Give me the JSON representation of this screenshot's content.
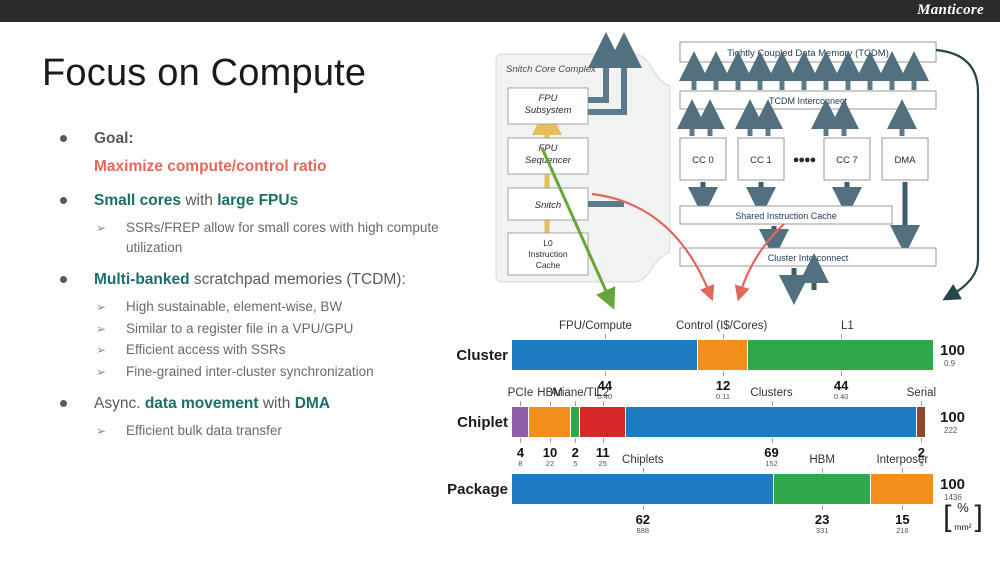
{
  "brand": "Manticore",
  "title": "Focus on Compute",
  "bullets": [
    {
      "kind": "l1",
      "parts": [
        {
          "t": "Goal:",
          "s": "gray-b"
        }
      ]
    },
    {
      "kind": "l1-cont",
      "parts": [
        {
          "t": "Maximize compute/control ratio",
          "s": "coral"
        }
      ]
    },
    {
      "kind": "l1",
      "parts": [
        {
          "t": "Small cores",
          "s": "teal"
        },
        {
          "t": " with ",
          "s": ""
        },
        {
          "t": "large FPUs",
          "s": "teal"
        }
      ]
    },
    {
      "kind": "l2",
      "parts": [
        {
          "t": "SSRs/FREP allow for small cores with high compute utilization",
          "s": ""
        }
      ]
    },
    {
      "kind": "l1",
      "parts": [
        {
          "t": "Multi-banked",
          "s": "teal"
        },
        {
          "t": " scratchpad memories (TCDM):",
          "s": ""
        }
      ]
    },
    {
      "kind": "l2",
      "parts": [
        {
          "t": "High sustainable, element-wise, BW",
          "s": ""
        }
      ]
    },
    {
      "kind": "l2",
      "parts": [
        {
          "t": "Similar to a register file in a VPU/GPU",
          "s": ""
        }
      ]
    },
    {
      "kind": "l2",
      "parts": [
        {
          "t": "Efficient access with SSRs",
          "s": ""
        }
      ]
    },
    {
      "kind": "l2",
      "parts": [
        {
          "t": "Fine-grained inter-cluster synchronization",
          "s": ""
        }
      ]
    },
    {
      "kind": "l1",
      "parts": [
        {
          "t": "Async. ",
          "s": ""
        },
        {
          "t": "data movement",
          "s": "teal"
        },
        {
          "t": " with ",
          "s": ""
        },
        {
          "t": "DMA",
          "s": "teal"
        }
      ]
    },
    {
      "kind": "l2",
      "parts": [
        {
          "t": "Efficient bulk data transfer",
          "s": ""
        }
      ]
    }
  ],
  "diagram": {
    "core_complex_label": "Snitch Core Complex",
    "blocks": {
      "fpu_subsystem": "FPU\nSubsystem",
      "fpu_sequencer": "FPU\nSequencer",
      "snitch": "Snitch",
      "l0_cache": "L0\nInstruction\nCache",
      "tcdm": "Tightly Coupled Data Memory (TCDM)",
      "tcdm_interconnect": "TCDM Interconnect",
      "cc0": "CC 0",
      "cc1": "CC 1",
      "cc_ellipsis": "● ● ● ●",
      "cc7": "CC 7",
      "dma": "DMA",
      "shared_icache": "Shared Instruction Cache",
      "cluster_interconnect": "Cluster Interconnect"
    },
    "annotations": [
      {
        "label": "FPU/Compute",
        "color": "#6aa539"
      },
      {
        "label": "Control (I$/Cores)",
        "color": "#e0675b"
      },
      {
        "label": "L1",
        "color": "#1f4e4a"
      }
    ]
  },
  "chart_data": {
    "type": "bar",
    "subtype": "stacked-horizontal-100",
    "title": "",
    "xlabel": "",
    "ylabel": "",
    "unit_primary": "%",
    "unit_secondary": "mm²",
    "colors": {
      "blue": "#1f7bc1",
      "orange": "#f28e1c",
      "green": "#2fa84c",
      "purple": "#8e5ea8",
      "red": "#d62828",
      "brown": "#8b4a2f"
    },
    "rows": [
      {
        "label": "Cluster",
        "total": "100",
        "total_sub": "0.9",
        "segments": [
          {
            "name": "FPU/Compute",
            "value": 44,
            "pct_label": "44",
            "sub_label": "0.40",
            "color": "#1f7bc1",
            "name_above": true
          },
          {
            "name": "Control (I$/Cores)",
            "value": 12,
            "pct_label": "12",
            "sub_label": "0.11",
            "color": "#f28e1c",
            "name_above": true
          },
          {
            "name": "L1",
            "value": 44,
            "pct_label": "44",
            "sub_label": "0.40",
            "color": "#2fa84c",
            "name_above": true
          }
        ]
      },
      {
        "label": "Chiplet",
        "total": "100",
        "total_sub": "222",
        "segments": [
          {
            "name": "PCIe",
            "value": 4,
            "pct_label": "4",
            "sub_label": "8",
            "color": "#8e5ea8",
            "name_above": true
          },
          {
            "name": "HBM",
            "value": 10,
            "pct_label": "10",
            "sub_label": "22",
            "color": "#f28e1c",
            "name_above": true
          },
          {
            "name": "Ariane/TL",
            "value": 2,
            "pct_label": "2",
            "sub_label": "5",
            "color": "#2fa84c",
            "name_above": true
          },
          {
            "name": "L2",
            "value": 11,
            "pct_label": "11",
            "sub_label": "25",
            "color": "#d62828",
            "name_above": true
          },
          {
            "name": "Clusters",
            "value": 69,
            "pct_label": "69",
            "sub_label": "152",
            "color": "#1f7bc1",
            "name_above": true
          },
          {
            "name": "Serial",
            "value": 2,
            "pct_label": "2",
            "sub_label": "3",
            "color": "#8b4a2f",
            "name_above": true
          }
        ]
      },
      {
        "label": "Package",
        "total": "100",
        "total_sub": "1436",
        "segments": [
          {
            "name": "Chiplets",
            "value": 62,
            "pct_label": "62",
            "sub_label": "888",
            "color": "#1f7bc1",
            "name_above": true
          },
          {
            "name": "HBM",
            "value": 23,
            "pct_label": "23",
            "sub_label": "331",
            "color": "#2fa84c",
            "name_above": true
          },
          {
            "name": "Interposer",
            "value": 15,
            "pct_label": "15",
            "sub_label": "216",
            "color": "#f28e1c",
            "name_above": true
          }
        ]
      }
    ]
  }
}
